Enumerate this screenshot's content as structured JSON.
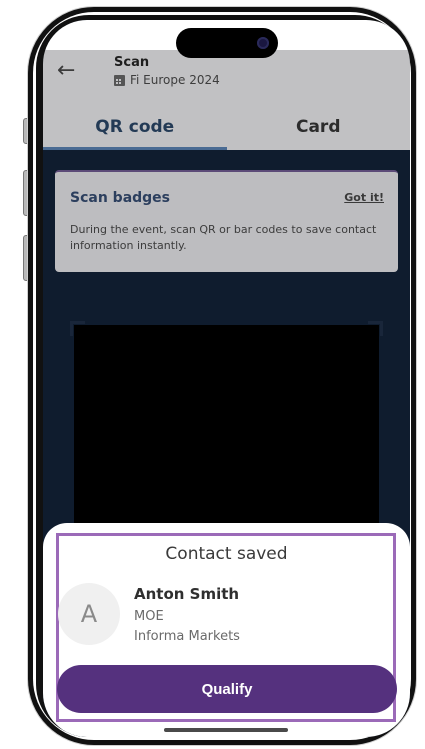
{
  "header": {
    "title": "Scan",
    "subtitle": "Fi Europe 2024"
  },
  "tabs": [
    {
      "label": "QR code",
      "active": true
    },
    {
      "label": "Card",
      "active": false
    }
  ],
  "scan_card": {
    "title": "Scan badges",
    "dismiss": "Got it!",
    "text": "During the event, scan QR or bar codes to save contact information instantly."
  },
  "contact_sheet": {
    "title": "Contact saved",
    "avatar_letter": "A",
    "name": "Anton Smith",
    "company": "MOE",
    "organization": "Informa Markets",
    "button": "Qualify"
  },
  "colors": {
    "accent": "#55317e",
    "highlight": "#9b6ab8",
    "header_bg": "#c1c1c3"
  }
}
